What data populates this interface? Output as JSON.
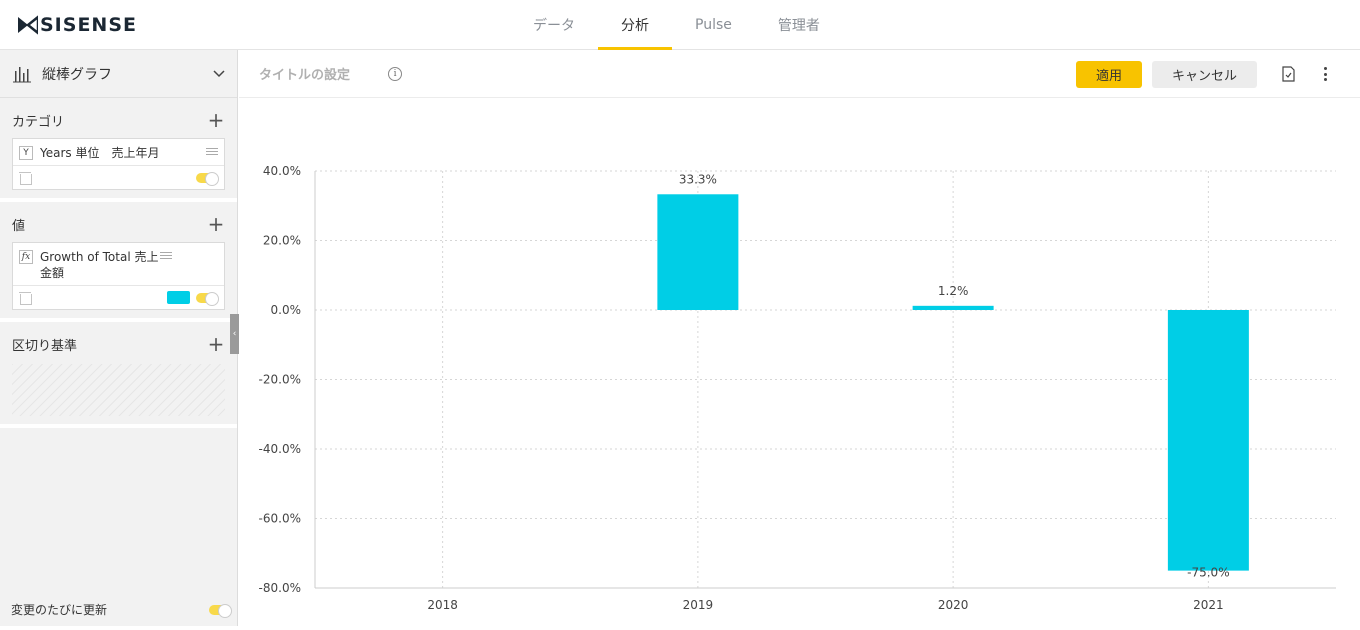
{
  "app": {
    "logo_text": "SISENSE"
  },
  "nav": {
    "tabs": [
      "データ",
      "分析",
      "Pulse",
      "管理者"
    ],
    "active": 1
  },
  "left_panel": {
    "chart_type": "縦棒グラフ",
    "category": {
      "title": "カテゴリ",
      "field_badge": "Y",
      "field_label": "Years 単位　売上年月"
    },
    "values": {
      "title": "値",
      "field_badge": "fx",
      "field_label": "Growth of Total 売上金額",
      "color": "#00cee6"
    },
    "breakby": {
      "title": "区切り基準"
    },
    "auto_update_label": "変更のたびに更新"
  },
  "toolbar": {
    "title_placeholder": "タイトルの設定",
    "apply_label": "適用",
    "cancel_label": "キャンセル"
  },
  "chart_data": {
    "type": "bar",
    "categories": [
      "2018",
      "2019",
      "2020",
      "2021"
    ],
    "series": [
      {
        "name": "Growth of Total 売上金額",
        "values": [
          null,
          33.3,
          1.2,
          -75.0
        ],
        "color": "#00cee6"
      }
    ],
    "data_labels": [
      "",
      "33.3%",
      "1.2%",
      "-75.0%"
    ],
    "ylim": [
      -80,
      40
    ],
    "yticks": [
      40,
      20,
      0,
      -20,
      -40,
      -60,
      -80
    ],
    "ytick_labels": [
      "40.0%",
      "20.0%",
      "0.0%",
      "-20.0%",
      "-40.0%",
      "-60.0%",
      "-80.0%"
    ],
    "grid": true,
    "legend_position": "bottom"
  }
}
